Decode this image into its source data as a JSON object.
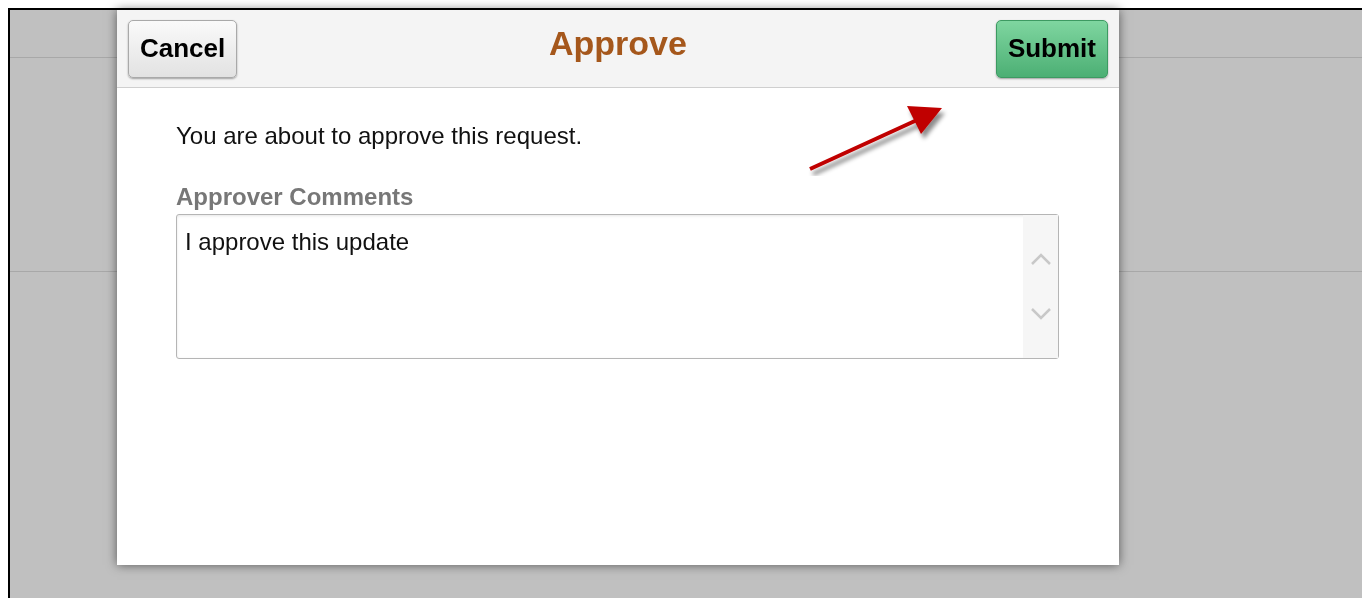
{
  "dialog": {
    "title": "Approve",
    "cancel_button": "Cancel",
    "submit_button": "Submit",
    "message": "You are about to approve this request.",
    "comments": {
      "label": "Approver Comments",
      "value": "I approve this update"
    }
  }
}
